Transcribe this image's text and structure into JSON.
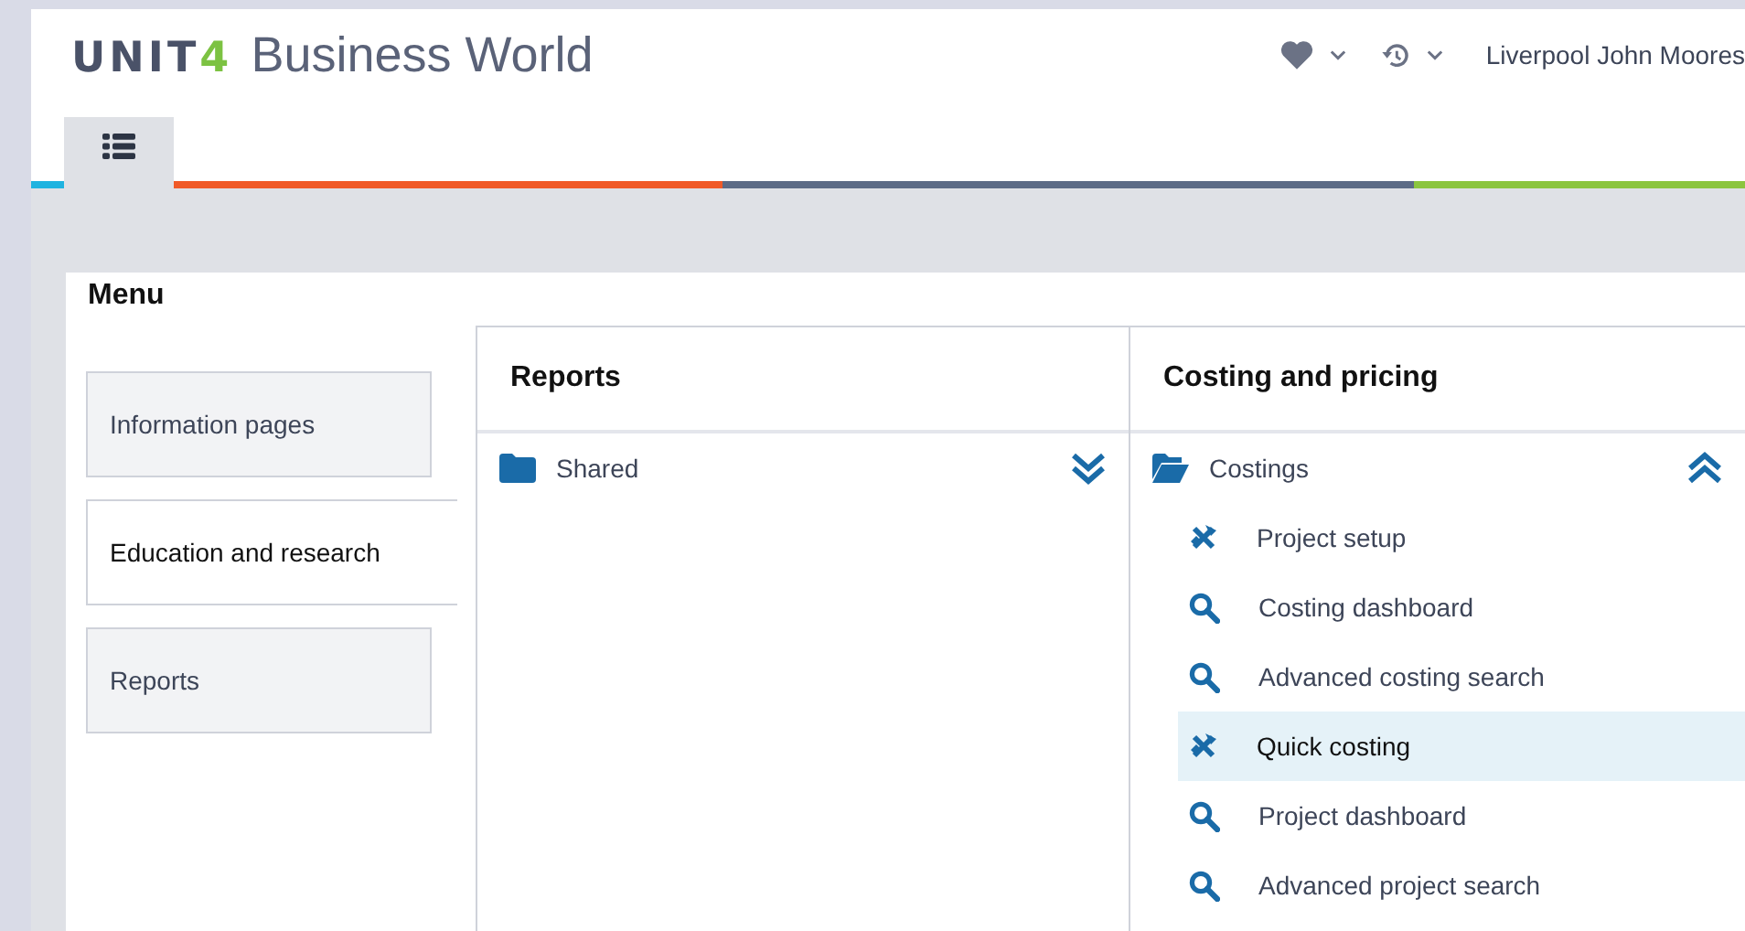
{
  "header": {
    "logo": "UNIT",
    "logo_accent": "4",
    "product": "Business World",
    "organisation": "Liverpool John Moores"
  },
  "tabs": [
    {
      "kind": "menu",
      "selected": true
    }
  ],
  "menu": {
    "title": "Menu",
    "sections": [
      {
        "label": "Information pages",
        "selected": false
      },
      {
        "label": "Education and research",
        "selected": true
      },
      {
        "label": "Reports",
        "selected": false
      }
    ],
    "columns": [
      {
        "title": "Reports",
        "folders": [
          {
            "label": "Shared",
            "expanded": false
          }
        ]
      },
      {
        "title": "Costing and pricing",
        "folders": [
          {
            "label": "Costings",
            "expanded": true,
            "items": [
              {
                "kind": "tools",
                "label": "Project setup",
                "selected": false
              },
              {
                "kind": "search",
                "label": "Costing dashboard",
                "selected": false
              },
              {
                "kind": "search",
                "label": "Advanced costing search",
                "selected": false
              },
              {
                "kind": "tools",
                "label": "Quick costing",
                "selected": true
              },
              {
                "kind": "search",
                "label": "Project dashboard",
                "selected": false
              },
              {
                "kind": "search",
                "label": "Advanced project search",
                "selected": false
              }
            ]
          }
        ]
      }
    ]
  }
}
